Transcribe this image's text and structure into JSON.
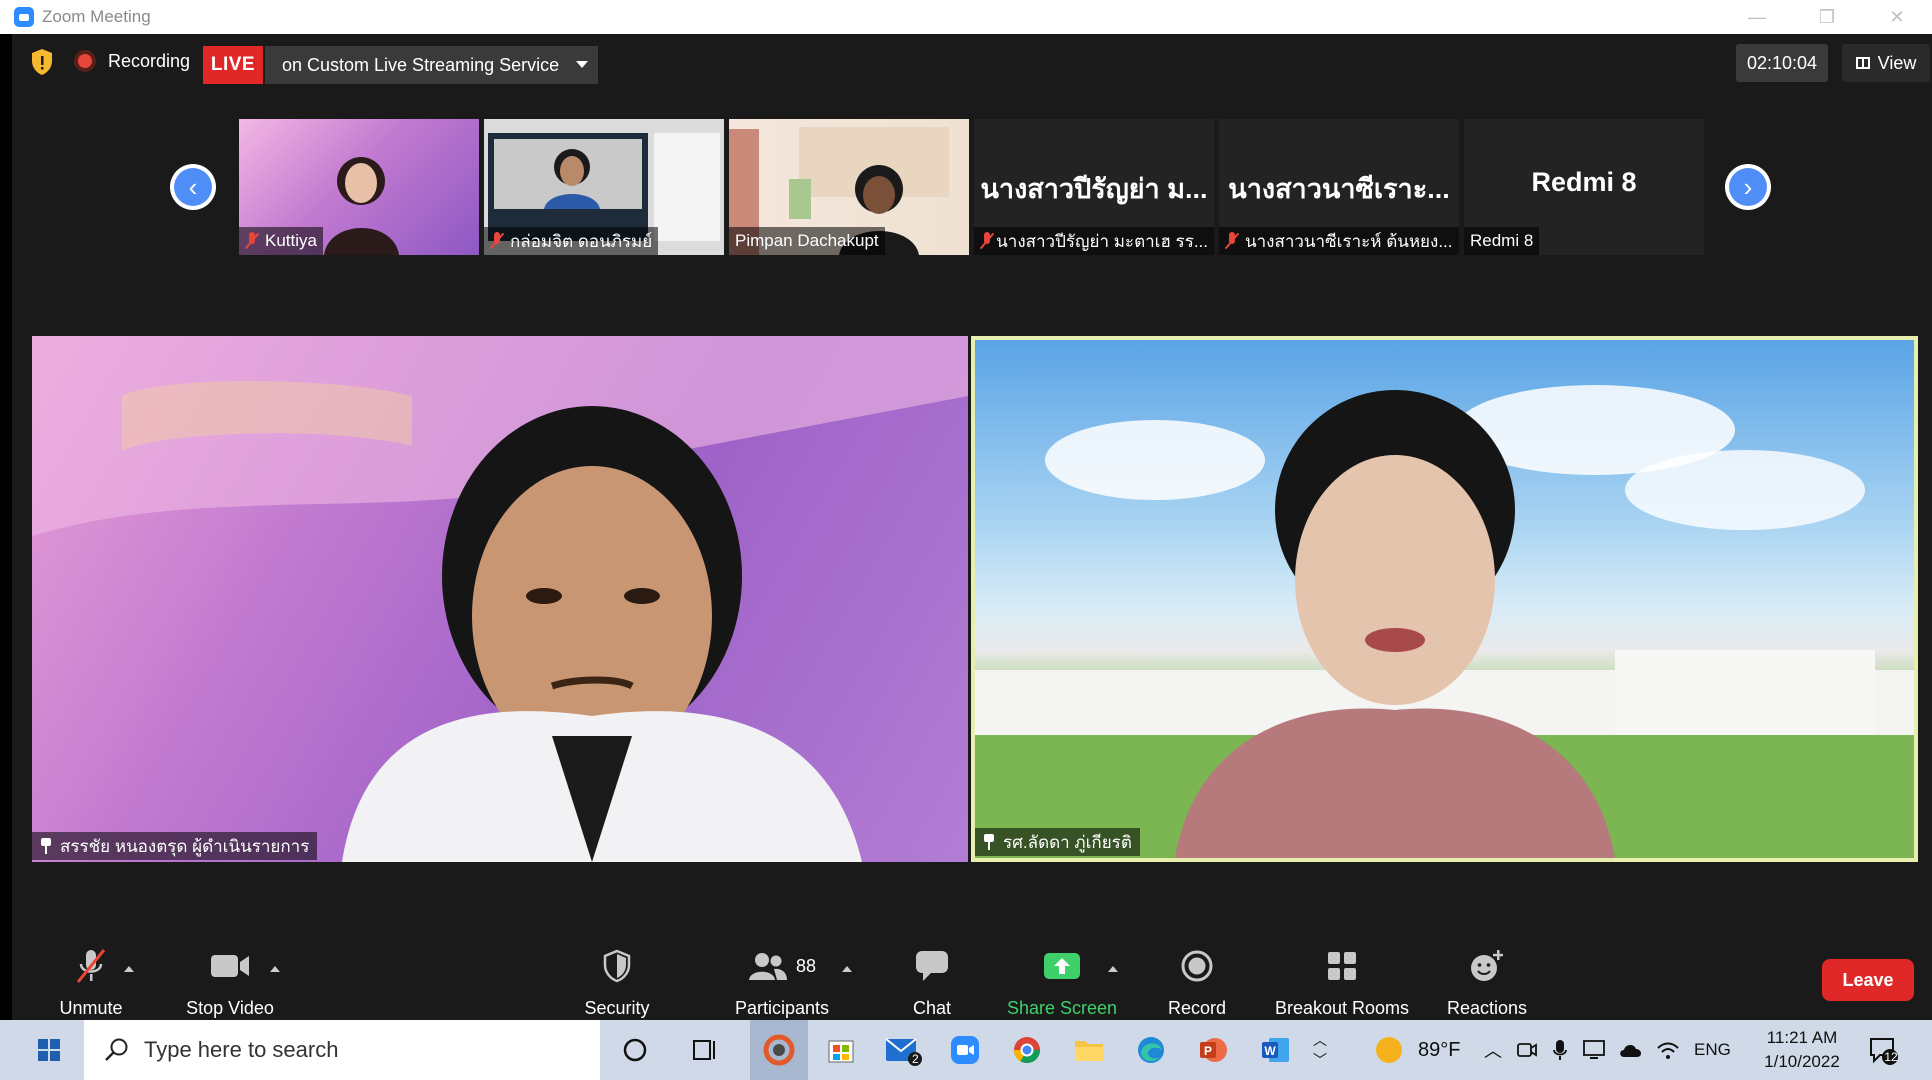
{
  "window": {
    "title": "Zoom Meeting",
    "minimize": "—",
    "restore": "❐",
    "close": "✕"
  },
  "topbar": {
    "recording_label": "Recording",
    "live_label": "LIVE",
    "stream_label": "on Custom Live Streaming Service",
    "timer": "02:10:04",
    "view_label": "View"
  },
  "thumbnails": [
    {
      "label": "Kuttiya",
      "muted": true
    },
    {
      "label": "กล่อมจิต ดอนภิรมย์",
      "muted": true
    },
    {
      "label": "Pimpan Dachakupt",
      "muted": false
    },
    {
      "bigname": "นางสาวปีรัญย่า ม...",
      "label": "นางสาวปีรัญย่า มะตาเฮ รร...",
      "muted": true
    },
    {
      "bigname": "นางสาวนาซีเราะ...",
      "label": "นางสาวนาซีเราะห์ ต้นหยง...",
      "muted": true
    },
    {
      "bigname": "Redmi 8",
      "label": "Redmi 8",
      "muted": false
    }
  ],
  "main": {
    "left_label": "สรรชัย หนองตรุด ผู้ดำเนินรายการ",
    "right_label": "รศ.ลัดดา ภู่เกียรติ"
  },
  "toolbar": {
    "unmute": "Unmute",
    "stop_video": "Stop Video",
    "security": "Security",
    "participants": "Participants",
    "participants_count": "88",
    "chat": "Chat",
    "share_screen": "Share Screen",
    "record": "Record",
    "breakout_rooms": "Breakout Rooms",
    "reactions": "Reactions",
    "leave": "Leave"
  },
  "taskbar": {
    "search_placeholder": "Type here to search",
    "weather": "89°F",
    "language": "ENG",
    "time": "11:21 AM",
    "date": "1/10/2022",
    "mail_badge": "2",
    "notification_count": "12"
  },
  "colors": {
    "live_red": "#e02828",
    "active_speaker_border": "#e7efae",
    "share_green": "#3fd06b",
    "nav_blue": "#4f8ef7"
  }
}
